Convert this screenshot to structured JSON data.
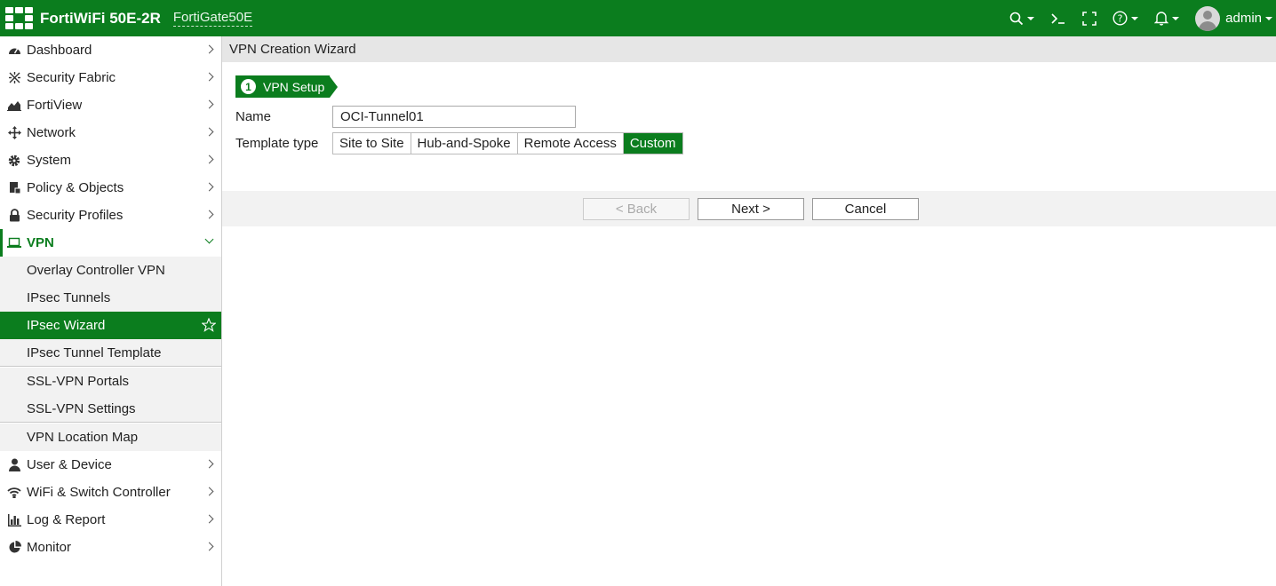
{
  "topbar": {
    "model": "FortiWiFi 50E-2R",
    "hostname": "FortiGate50E",
    "user": "admin",
    "icons": [
      "search-icon",
      "cli-console-icon",
      "fullscreen-icon",
      "help-icon",
      "notification-bell-icon",
      "user-avatar"
    ],
    "bar_color": "#0b7d1e"
  },
  "sidebar": {
    "items_top": [
      {
        "label": "Dashboard",
        "icon": "dashboard-icon"
      },
      {
        "label": "Security Fabric",
        "icon": "security-fabric-icon"
      },
      {
        "label": "FortiView",
        "icon": "fortiview-chart-icon"
      },
      {
        "label": "Network",
        "icon": "network-arrows-icon"
      },
      {
        "label": "System",
        "icon": "gear-icon"
      },
      {
        "label": "Policy & Objects",
        "icon": "policy-document-icon"
      },
      {
        "label": "Security Profiles",
        "icon": "lock-icon"
      }
    ],
    "vpn": {
      "label": "VPN",
      "icon": "laptop-icon",
      "subitems": [
        "Overlay Controller VPN",
        "IPsec Tunnels",
        "IPsec Wizard",
        "IPsec Tunnel Template",
        "SSL-VPN Portals",
        "SSL-VPN Settings",
        "VPN Location Map"
      ],
      "active": "IPsec Wizard"
    },
    "items_bottom": [
      {
        "label": "User & Device",
        "icon": "user-icon"
      },
      {
        "label": "WiFi & Switch Controller",
        "icon": "wifi-icon"
      },
      {
        "label": "Log & Report",
        "icon": "log-chart-icon"
      },
      {
        "label": "Monitor",
        "icon": "monitor-pie-icon"
      }
    ]
  },
  "main": {
    "title": "VPN Creation Wizard",
    "step": {
      "number": "1",
      "label": "VPN Setup"
    },
    "name_label": "Name",
    "name_value": "OCI-Tunnel01",
    "template_label": "Template type",
    "template_options": [
      "Site to Site",
      "Hub-and-Spoke",
      "Remote Access",
      "Custom"
    ],
    "template_selected": "Custom",
    "buttons": {
      "back": "< Back",
      "next": "Next >",
      "cancel": "Cancel"
    }
  }
}
